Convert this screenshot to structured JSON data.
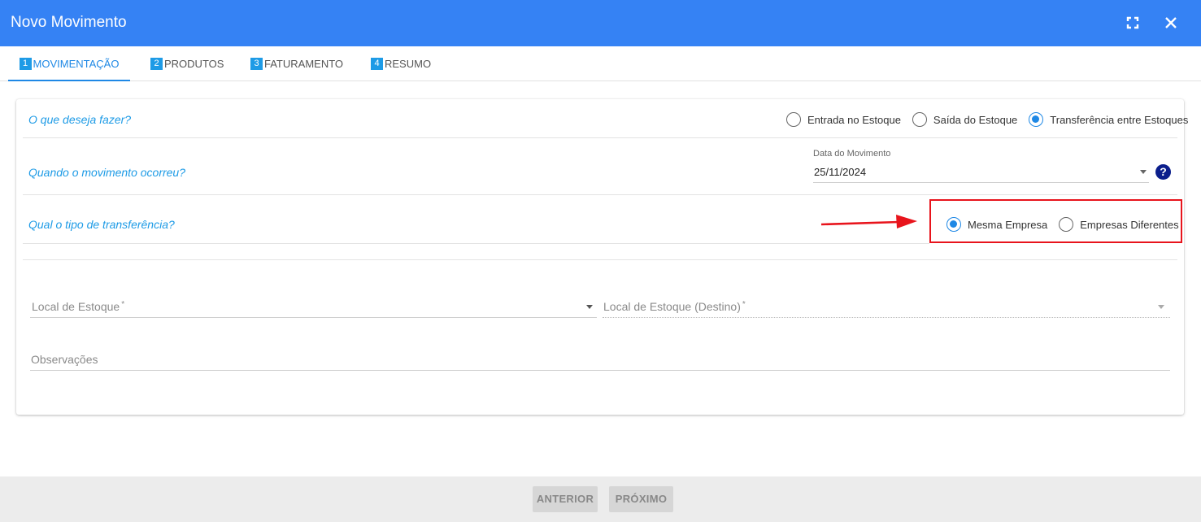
{
  "window": {
    "title": "Novo Movimento"
  },
  "tabs": [
    {
      "num": "1",
      "label": "MOVIMENTAÇÃO",
      "active": true
    },
    {
      "num": "2",
      "label": "PRODUTOS",
      "active": false
    },
    {
      "num": "3",
      "label": "FATURAMENTO",
      "active": false
    },
    {
      "num": "4",
      "label": "RESUMO",
      "active": false
    }
  ],
  "form": {
    "q_action": "O que deseja fazer?",
    "action_options": [
      {
        "label": "Entrada no Estoque",
        "checked": false
      },
      {
        "label": "Saída do Estoque",
        "checked": false
      },
      {
        "label": "Transferência entre Estoques",
        "checked": true
      }
    ],
    "q_when": "Quando o movimento ocorreu?",
    "date_label": "Data do Movimento",
    "date_value": "25/11/2024",
    "help_glyph": "?",
    "q_transfer_type": "Qual o tipo de transferência?",
    "transfer_options": [
      {
        "label": "Mesma Empresa",
        "checked": true
      },
      {
        "label": "Empresas Diferentes",
        "checked": false
      }
    ],
    "stock_local_label": "Local de Estoque",
    "stock_local_dest_label": "Local de Estoque (Destino)",
    "required_mark": "*",
    "notes_label": "Observações"
  },
  "footer": {
    "prev_label": "ANTERIOR",
    "next_label": "PRÓXIMO"
  },
  "colors": {
    "titlebar": "#3582f4",
    "accent": "#1e88e5",
    "question": "#1e9be6",
    "annotation": "#e8141c"
  }
}
